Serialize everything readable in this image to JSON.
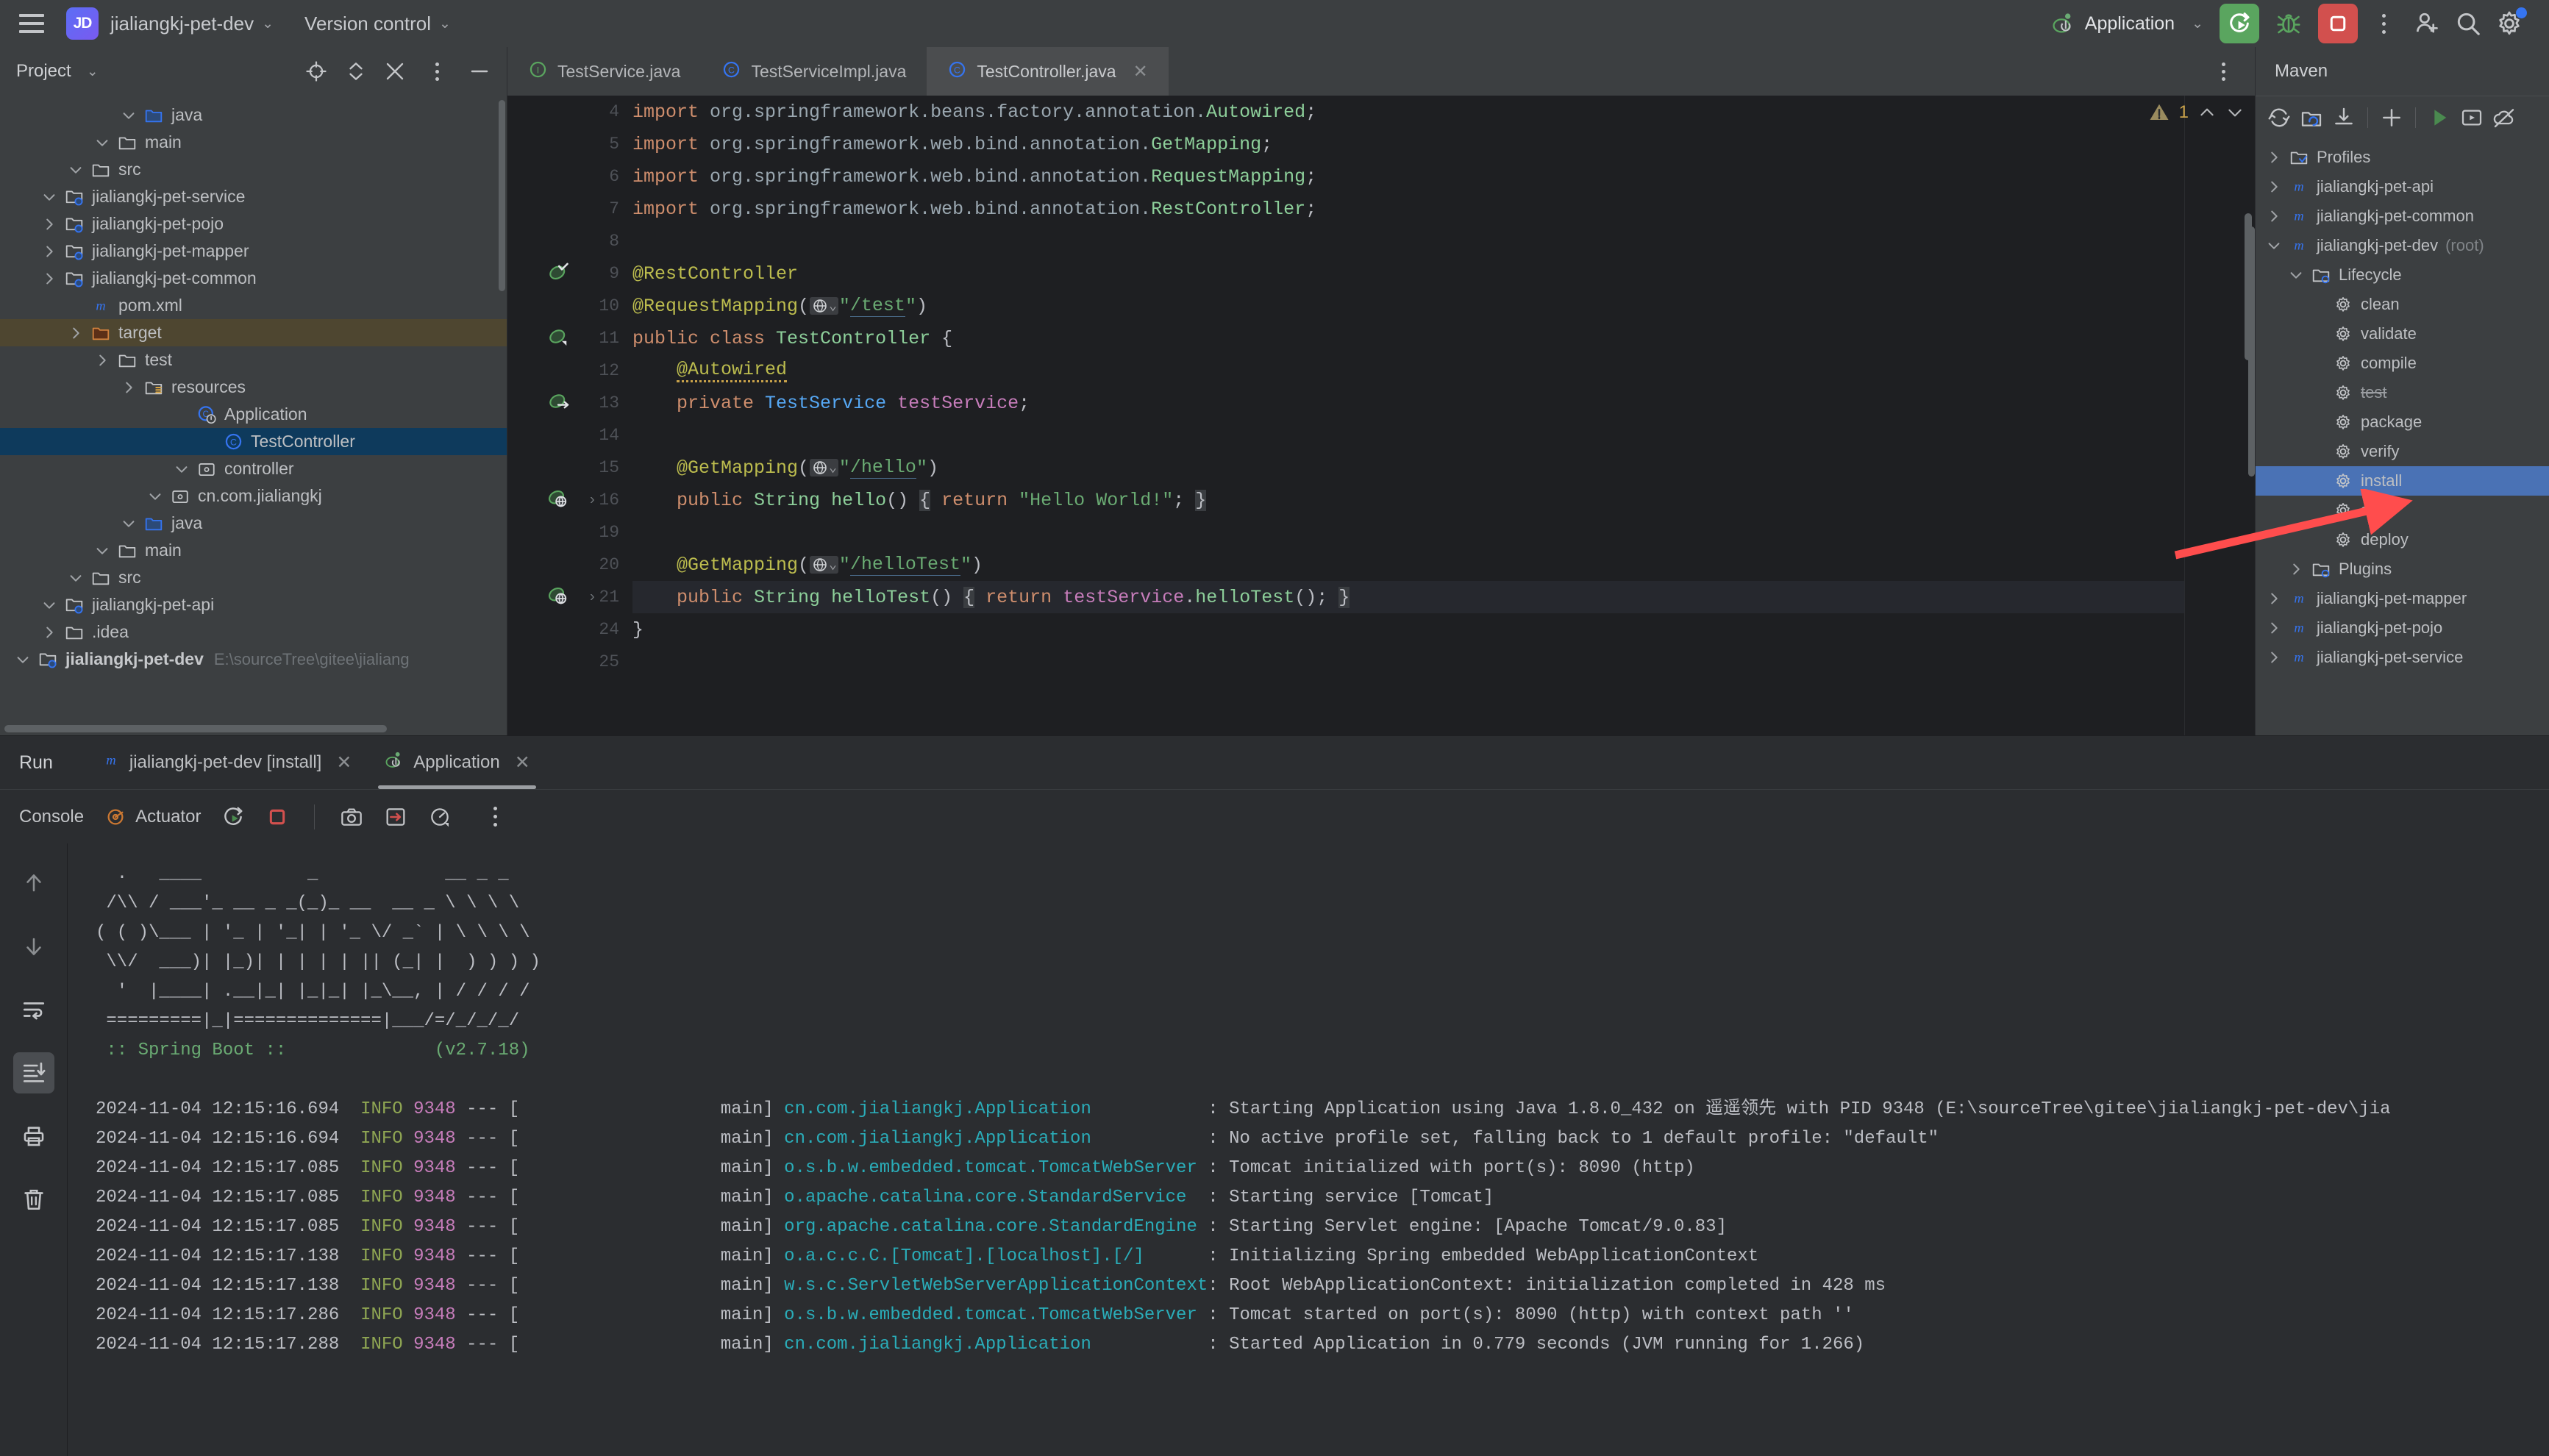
{
  "topbar": {
    "menu_icon": "hamburger-icon",
    "project_badge": "JD",
    "project_name": "jialiangkj-pet-dev",
    "version_control": "Version control",
    "run_config": "Application",
    "icons": [
      "run-icon",
      "debug-icon",
      "stop-icon",
      "more-icon",
      "add-user-icon",
      "search-icon",
      "settings-icon"
    ]
  },
  "project_panel": {
    "title": "Project",
    "toolbar_icons": [
      "select-opened-file-icon",
      "expand-collapse-icon",
      "collapse-all-icon",
      "options-icon",
      "hide-icon"
    ],
    "tree": [
      {
        "indent": 0,
        "arrow": "down",
        "icon": "module-folder",
        "label": "jialiangkj-pet-dev",
        "bold": true,
        "path": "E:\\sourceTree\\gitee\\jialiang"
      },
      {
        "indent": 1,
        "arrow": "right",
        "icon": "folder",
        "label": ".idea"
      },
      {
        "indent": 1,
        "arrow": "down",
        "icon": "module-folder",
        "label": "jialiangkj-pet-api"
      },
      {
        "indent": 2,
        "arrow": "down",
        "icon": "folder",
        "label": "src"
      },
      {
        "indent": 3,
        "arrow": "down",
        "icon": "folder",
        "label": "main"
      },
      {
        "indent": 4,
        "arrow": "down",
        "icon": "source-folder",
        "label": "java"
      },
      {
        "indent": 5,
        "arrow": "down",
        "icon": "package",
        "label": "cn.com.jialiangkj"
      },
      {
        "indent": 6,
        "arrow": "down",
        "icon": "package",
        "label": "controller"
      },
      {
        "indent": 7,
        "arrow": "",
        "icon": "class",
        "label": "TestController",
        "selected": true
      },
      {
        "indent": 6,
        "arrow": "",
        "icon": "class-run",
        "label": "Application"
      },
      {
        "indent": 4,
        "arrow": "right",
        "icon": "resource-folder",
        "label": "resources"
      },
      {
        "indent": 3,
        "arrow": "right",
        "icon": "folder",
        "label": "test"
      },
      {
        "indent": 2,
        "arrow": "right",
        "icon": "excluded-folder",
        "label": "target",
        "highlight": true
      },
      {
        "indent": 2,
        "arrow": "",
        "icon": "maven-file",
        "label": "pom.xml"
      },
      {
        "indent": 1,
        "arrow": "right",
        "icon": "module-folder",
        "label": "jialiangkj-pet-common"
      },
      {
        "indent": 1,
        "arrow": "right",
        "icon": "module-folder",
        "label": "jialiangkj-pet-mapper"
      },
      {
        "indent": 1,
        "arrow": "right",
        "icon": "module-folder",
        "label": "jialiangkj-pet-pojo"
      },
      {
        "indent": 1,
        "arrow": "down",
        "icon": "module-folder",
        "label": "jialiangkj-pet-service"
      },
      {
        "indent": 2,
        "arrow": "down",
        "icon": "folder",
        "label": "src"
      },
      {
        "indent": 3,
        "arrow": "down",
        "icon": "folder",
        "label": "main"
      },
      {
        "indent": 4,
        "arrow": "down",
        "icon": "source-folder",
        "label": "java"
      }
    ]
  },
  "editor": {
    "tabs": [
      {
        "label": "TestService.java",
        "icon": "interface-icon",
        "active": false,
        "closable": false
      },
      {
        "label": "TestServiceImpl.java",
        "icon": "class-icon",
        "active": false,
        "closable": false
      },
      {
        "label": "TestController.java",
        "icon": "class-icon",
        "active": true,
        "closable": true
      }
    ],
    "warning_count": "1",
    "lines": [
      {
        "num": "4",
        "gutter": "",
        "segs": [
          {
            "t": "import ",
            "c": "kw"
          },
          {
            "t": "org.springframework.beans.factory.annotation.",
            "c": "pkg"
          },
          {
            "t": "Autowired",
            "c": "typ"
          },
          {
            "t": ";",
            "c": "plain"
          }
        ]
      },
      {
        "num": "5",
        "gutter": "",
        "segs": [
          {
            "t": "import ",
            "c": "kw"
          },
          {
            "t": "org.springframework.web.bind.annotation.",
            "c": "pkg"
          },
          {
            "t": "GetMapping",
            "c": "typ"
          },
          {
            "t": ";",
            "c": "plain"
          }
        ]
      },
      {
        "num": "6",
        "gutter": "",
        "segs": [
          {
            "t": "import ",
            "c": "kw"
          },
          {
            "t": "org.springframework.web.bind.annotation.",
            "c": "pkg"
          },
          {
            "t": "RequestMapping",
            "c": "typ"
          },
          {
            "t": ";",
            "c": "plain"
          }
        ]
      },
      {
        "num": "7",
        "gutter": "",
        "segs": [
          {
            "t": "import ",
            "c": "kw"
          },
          {
            "t": "org.springframework.web.bind.annotation.",
            "c": "pkg"
          },
          {
            "t": "RestController",
            "c": "typ"
          },
          {
            "t": ";",
            "c": "plain"
          }
        ]
      },
      {
        "num": "8",
        "gutter": "",
        "segs": []
      },
      {
        "num": "9",
        "gutter": "bean-check",
        "segs": [
          {
            "t": "@RestController",
            "c": "anno"
          }
        ]
      },
      {
        "num": "10",
        "gutter": "",
        "segs": [
          {
            "t": "@RequestMapping",
            "c": "anno"
          },
          {
            "t": "(",
            "c": "plain"
          },
          {
            "t": "GLOBE",
            "c": "glob"
          },
          {
            "t": "\"",
            "c": "str"
          },
          {
            "t": "/test",
            "c": "urlstr"
          },
          {
            "t": "\"",
            "c": "str"
          },
          {
            "t": ")",
            "c": "plain"
          }
        ]
      },
      {
        "num": "11",
        "gutter": "bean",
        "segs": [
          {
            "t": "public class ",
            "c": "kw"
          },
          {
            "t": "TestController",
            "c": "typ"
          },
          {
            "t": " {",
            "c": "plain"
          }
        ]
      },
      {
        "num": "12",
        "gutter": "",
        "segs": [
          {
            "t": "    ",
            "c": "plain"
          },
          {
            "t": "@Autowired",
            "c": "anno squiggle"
          }
        ]
      },
      {
        "num": "13",
        "gutter": "bean-arrow",
        "segs": [
          {
            "t": "    ",
            "c": "plain"
          },
          {
            "t": "private ",
            "c": "kw"
          },
          {
            "t": "TestService",
            "c": "cls2"
          },
          {
            "t": " ",
            "c": "plain"
          },
          {
            "t": "testService",
            "c": "fld"
          },
          {
            "t": ";",
            "c": "plain"
          }
        ]
      },
      {
        "num": "14",
        "gutter": "",
        "segs": []
      },
      {
        "num": "15",
        "gutter": "",
        "segs": [
          {
            "t": "    ",
            "c": "plain"
          },
          {
            "t": "@GetMapping",
            "c": "anno"
          },
          {
            "t": "(",
            "c": "plain"
          },
          {
            "t": "GLOBE",
            "c": "glob"
          },
          {
            "t": "\"",
            "c": "str"
          },
          {
            "t": "/hello",
            "c": "urlstr"
          },
          {
            "t": "\"",
            "c": "str"
          },
          {
            "t": ")",
            "c": "plain"
          }
        ]
      },
      {
        "num": "16",
        "gutter": "mapping",
        "fold": true,
        "segs": [
          {
            "t": "    ",
            "c": "plain"
          },
          {
            "t": "public ",
            "c": "kw"
          },
          {
            "t": "String",
            "c": "typ"
          },
          {
            "t": " ",
            "c": "plain"
          },
          {
            "t": "hello",
            "c": "typ"
          },
          {
            "t": "() ",
            "c": "plain"
          },
          {
            "t": "{",
            "c": "plain brace-hl"
          },
          {
            "t": " ",
            "c": "plain"
          },
          {
            "t": "return ",
            "c": "kw"
          },
          {
            "t": "\"Hello World!\"",
            "c": "str"
          },
          {
            "t": "; ",
            "c": "plain"
          },
          {
            "t": "}",
            "c": "plain brace-hl"
          }
        ]
      },
      {
        "num": "19",
        "gutter": "",
        "segs": []
      },
      {
        "num": "20",
        "gutter": "",
        "segs": [
          {
            "t": "    ",
            "c": "plain"
          },
          {
            "t": "@GetMapping",
            "c": "anno"
          },
          {
            "t": "(",
            "c": "plain"
          },
          {
            "t": "GLOBE",
            "c": "glob"
          },
          {
            "t": "\"",
            "c": "str"
          },
          {
            "t": "/helloTest",
            "c": "urlstr"
          },
          {
            "t": "\"",
            "c": "str"
          },
          {
            "t": ")",
            "c": "plain"
          }
        ]
      },
      {
        "num": "21",
        "gutter": "mapping",
        "fold": true,
        "current": true,
        "segs": [
          {
            "t": "    ",
            "c": "plain"
          },
          {
            "t": "public ",
            "c": "kw"
          },
          {
            "t": "String",
            "c": "typ"
          },
          {
            "t": " ",
            "c": "plain"
          },
          {
            "t": "helloTest",
            "c": "typ"
          },
          {
            "t": "() ",
            "c": "plain"
          },
          {
            "t": "{",
            "c": "plain brace-hl"
          },
          {
            "t": " ",
            "c": "plain"
          },
          {
            "t": "return ",
            "c": "kw"
          },
          {
            "t": "testService",
            "c": "fld"
          },
          {
            "t": ".",
            "c": "plain"
          },
          {
            "t": "helloTest",
            "c": "typ"
          },
          {
            "t": "(); ",
            "c": "plain"
          },
          {
            "t": "}",
            "c": "plain brace-hl"
          }
        ]
      },
      {
        "num": "24",
        "gutter": "",
        "segs": [
          {
            "t": "}",
            "c": "plain"
          }
        ]
      },
      {
        "num": "25",
        "gutter": "",
        "segs": []
      }
    ]
  },
  "maven": {
    "title": "Maven",
    "toolbar_icons": [
      "reload-icon",
      "reload-project-icon",
      "download-sources-icon",
      "add-icon",
      "run-maven-build-icon",
      "execute-goal-icon",
      "offline-mode-icon"
    ],
    "tree": [
      {
        "indent": 0,
        "arrow": "right",
        "icon": "profiles-folder",
        "label": "Profiles"
      },
      {
        "indent": 0,
        "arrow": "right",
        "icon": "maven-module",
        "label": "jialiangkj-pet-api"
      },
      {
        "indent": 0,
        "arrow": "right",
        "icon": "maven-module",
        "label": "jialiangkj-pet-common"
      },
      {
        "indent": 0,
        "arrow": "down",
        "icon": "maven-module",
        "label": "jialiangkj-pet-dev",
        "suffix": "(root)"
      },
      {
        "indent": 1,
        "arrow": "down",
        "icon": "lifecycle-folder",
        "label": "Lifecycle"
      },
      {
        "indent": 2,
        "arrow": "",
        "icon": "goal",
        "label": "clean"
      },
      {
        "indent": 2,
        "arrow": "",
        "icon": "goal",
        "label": "validate"
      },
      {
        "indent": 2,
        "arrow": "",
        "icon": "goal",
        "label": "compile"
      },
      {
        "indent": 2,
        "arrow": "",
        "icon": "goal",
        "label": "test",
        "strike": true
      },
      {
        "indent": 2,
        "arrow": "",
        "icon": "goal",
        "label": "package"
      },
      {
        "indent": 2,
        "arrow": "",
        "icon": "goal",
        "label": "verify"
      },
      {
        "indent": 2,
        "arrow": "",
        "icon": "goal",
        "label": "install",
        "selected": true
      },
      {
        "indent": 2,
        "arrow": "",
        "icon": "goal",
        "label": "site"
      },
      {
        "indent": 2,
        "arrow": "",
        "icon": "goal",
        "label": "deploy"
      },
      {
        "indent": 1,
        "arrow": "right",
        "icon": "plugins-folder",
        "label": "Plugins"
      },
      {
        "indent": 0,
        "arrow": "right",
        "icon": "maven-module",
        "label": "jialiangkj-pet-mapper"
      },
      {
        "indent": 0,
        "arrow": "right",
        "icon": "maven-module",
        "label": "jialiangkj-pet-pojo"
      },
      {
        "indent": 0,
        "arrow": "right",
        "icon": "maven-module",
        "label": "jialiangkj-pet-service"
      }
    ]
  },
  "run_panel": {
    "label": "Run",
    "tabs": [
      {
        "label": "jialiangkj-pet-dev [install]",
        "icon": "maven-icon",
        "active": false,
        "closable": true
      },
      {
        "label": "Application",
        "icon": "spring-icon",
        "active": true,
        "closable": true
      }
    ],
    "toolbar": [
      {
        "label": "Console",
        "icon": "",
        "active": true
      },
      {
        "label": "Actuator",
        "icon": "actuator-icon",
        "active": false
      }
    ],
    "toolbar_icons": [
      "rerun-icon",
      "stop-icon",
      "camera-icon",
      "export-icon",
      "profiler-icon",
      "more-icon"
    ],
    "side_icons": [
      "soft-wrap-up-icon",
      "soft-wrap-down-icon",
      "wrap-text-icon",
      "scroll-to-end-icon",
      "print-icon",
      "clear-all-icon"
    ],
    "banner": [
      "  .   ____          _            __ _ _",
      " /\\\\ / ___'_ __ _ _(_)_ __  __ _ \\ \\ \\ \\",
      "( ( )\\___ | '_ | '_| | '_ \\/ _` | \\ \\ \\ \\",
      " \\\\/  ___)| |_)| | | | | || (_| |  ) ) ) )",
      "  '  |____| .__|_| |_|_| |_\\__, | / / / /",
      " =========|_|==============|___/=/_/_/_/"
    ],
    "banner_footer_left": " :: Spring Boot ::",
    "banner_footer_right": "(v2.7.18)",
    "logs": [
      {
        "ts": "2024-11-04 12:15:16.694",
        "level": "INFO",
        "pid": "9348",
        "thread": "main",
        "logger": "cn.com.jialiangkj.Application",
        "msg": "Starting Application using Java 1.8.0_432 on 遥遥领先 with PID 9348 (E:\\sourceTree\\gitee\\jialiangkj-pet-dev\\jia"
      },
      {
        "ts": "2024-11-04 12:15:16.694",
        "level": "INFO",
        "pid": "9348",
        "thread": "main",
        "logger": "cn.com.jialiangkj.Application",
        "msg": "No active profile set, falling back to 1 default profile: \"default\""
      },
      {
        "ts": "2024-11-04 12:15:17.085",
        "level": "INFO",
        "pid": "9348",
        "thread": "main",
        "logger": "o.s.b.w.embedded.tomcat.TomcatWebServer",
        "msg": "Tomcat initialized with port(s): 8090 (http)"
      },
      {
        "ts": "2024-11-04 12:15:17.085",
        "level": "INFO",
        "pid": "9348",
        "thread": "main",
        "logger": "o.apache.catalina.core.StandardService",
        "msg": "Starting service [Tomcat]"
      },
      {
        "ts": "2024-11-04 12:15:17.085",
        "level": "INFO",
        "pid": "9348",
        "thread": "main",
        "logger": "org.apache.catalina.core.StandardEngine",
        "msg": "Starting Servlet engine: [Apache Tomcat/9.0.83]"
      },
      {
        "ts": "2024-11-04 12:15:17.138",
        "level": "INFO",
        "pid": "9348",
        "thread": "main",
        "logger": "o.a.c.c.C.[Tomcat].[localhost].[/]",
        "msg": "Initializing Spring embedded WebApplicationContext"
      },
      {
        "ts": "2024-11-04 12:15:17.138",
        "level": "INFO",
        "pid": "9348",
        "thread": "main",
        "logger": "w.s.c.ServletWebServerApplicationContext",
        "msg": "Root WebApplicationContext: initialization completed in 428 ms"
      },
      {
        "ts": "2024-11-04 12:15:17.286",
        "level": "INFO",
        "pid": "9348",
        "thread": "main",
        "logger": "o.s.b.w.embedded.tomcat.TomcatWebServer",
        "msg": "Tomcat started on port(s): 8090 (http) with context path ''"
      },
      {
        "ts": "2024-11-04 12:15:17.288",
        "level": "INFO",
        "pid": "9348",
        "thread": "main",
        "logger": "cn.com.jialiangkj.Application",
        "msg": "Started Application in 0.779 seconds (JVM running for 1.266)"
      }
    ]
  },
  "annotation": {
    "arrow_color": "#ff4d4d",
    "points_to": "install"
  },
  "colors": {
    "accent_blue": "#4a72b5",
    "run_green": "#5aa55f",
    "stop_red": "#d2504e",
    "selection_navy": "#0e3a5c"
  }
}
